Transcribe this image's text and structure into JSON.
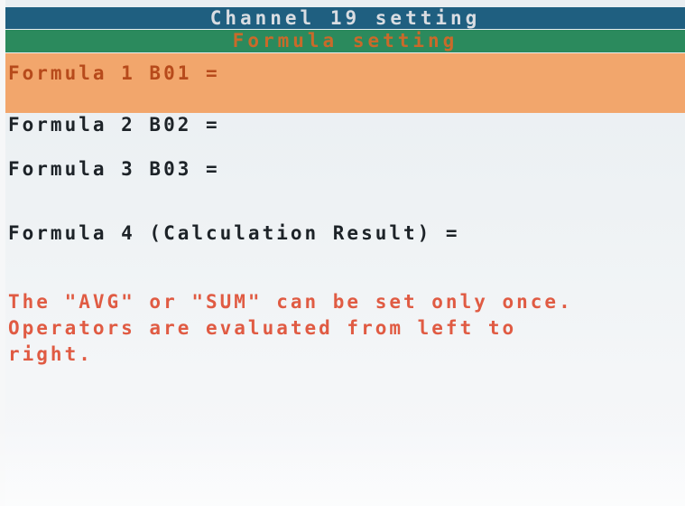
{
  "window": {
    "title": "Channel 19 setting",
    "subtitle": "Formula setting"
  },
  "formulas": [
    {
      "label": "Formula 1 B01 =",
      "selected": true
    },
    {
      "label": "Formula 2 B02 =",
      "selected": false
    },
    {
      "label": "Formula 3 B03 =",
      "selected": false
    },
    {
      "label": "Formula 4 (Calculation Result) =",
      "selected": false
    }
  ],
  "message": {
    "line1": "The \"AVG\" or \"SUM\" can be set only once.",
    "line2": "Operators are evaluated from left to",
    "line3": "right."
  },
  "colors": {
    "title_bar": "#1f5f80",
    "subtitle_bar": "#2b8a5d",
    "selection": "#f2a66c",
    "message_text": "#e05b43"
  }
}
